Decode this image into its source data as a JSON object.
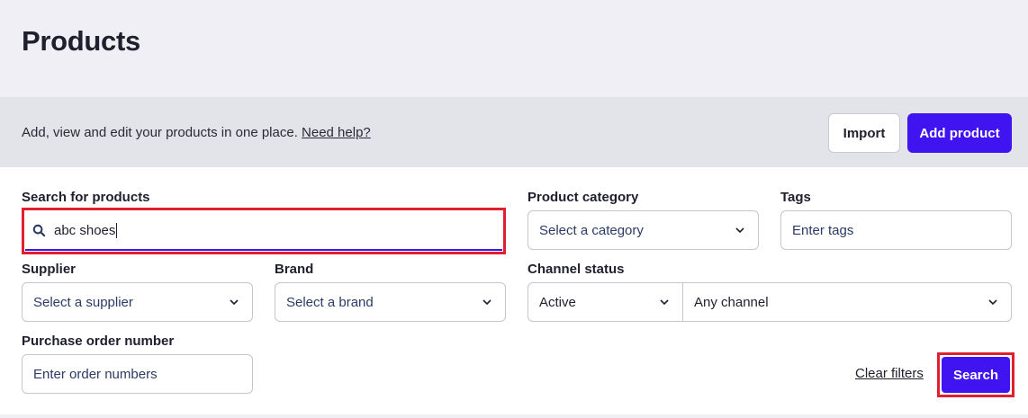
{
  "header": {
    "title": "Products"
  },
  "info_bar": {
    "description": "Add, view and edit your products in one place.",
    "help_link": "Need help?",
    "import_label": "Import",
    "add_label": "Add product"
  },
  "filters": {
    "search": {
      "label": "Search for products",
      "value": "abc shoes",
      "icon": "search-icon"
    },
    "category": {
      "label": "Product category",
      "placeholder": "Select a category"
    },
    "tags": {
      "label": "Tags",
      "placeholder": "Enter tags"
    },
    "supplier": {
      "label": "Supplier",
      "placeholder": "Select a supplier"
    },
    "brand": {
      "label": "Brand",
      "placeholder": "Select a brand"
    },
    "channel_status": {
      "label": "Channel status",
      "status_value": "Active",
      "channel_value": "Any channel"
    },
    "purchase_order": {
      "label": "Purchase order number",
      "placeholder": "Enter order numbers"
    }
  },
  "actions": {
    "clear_label": "Clear filters",
    "search_label": "Search"
  },
  "colors": {
    "accent": "#3f14f0",
    "highlight": "#e0202e",
    "header_bg": "#efeff5",
    "bar_bg": "#e3e3ea"
  }
}
